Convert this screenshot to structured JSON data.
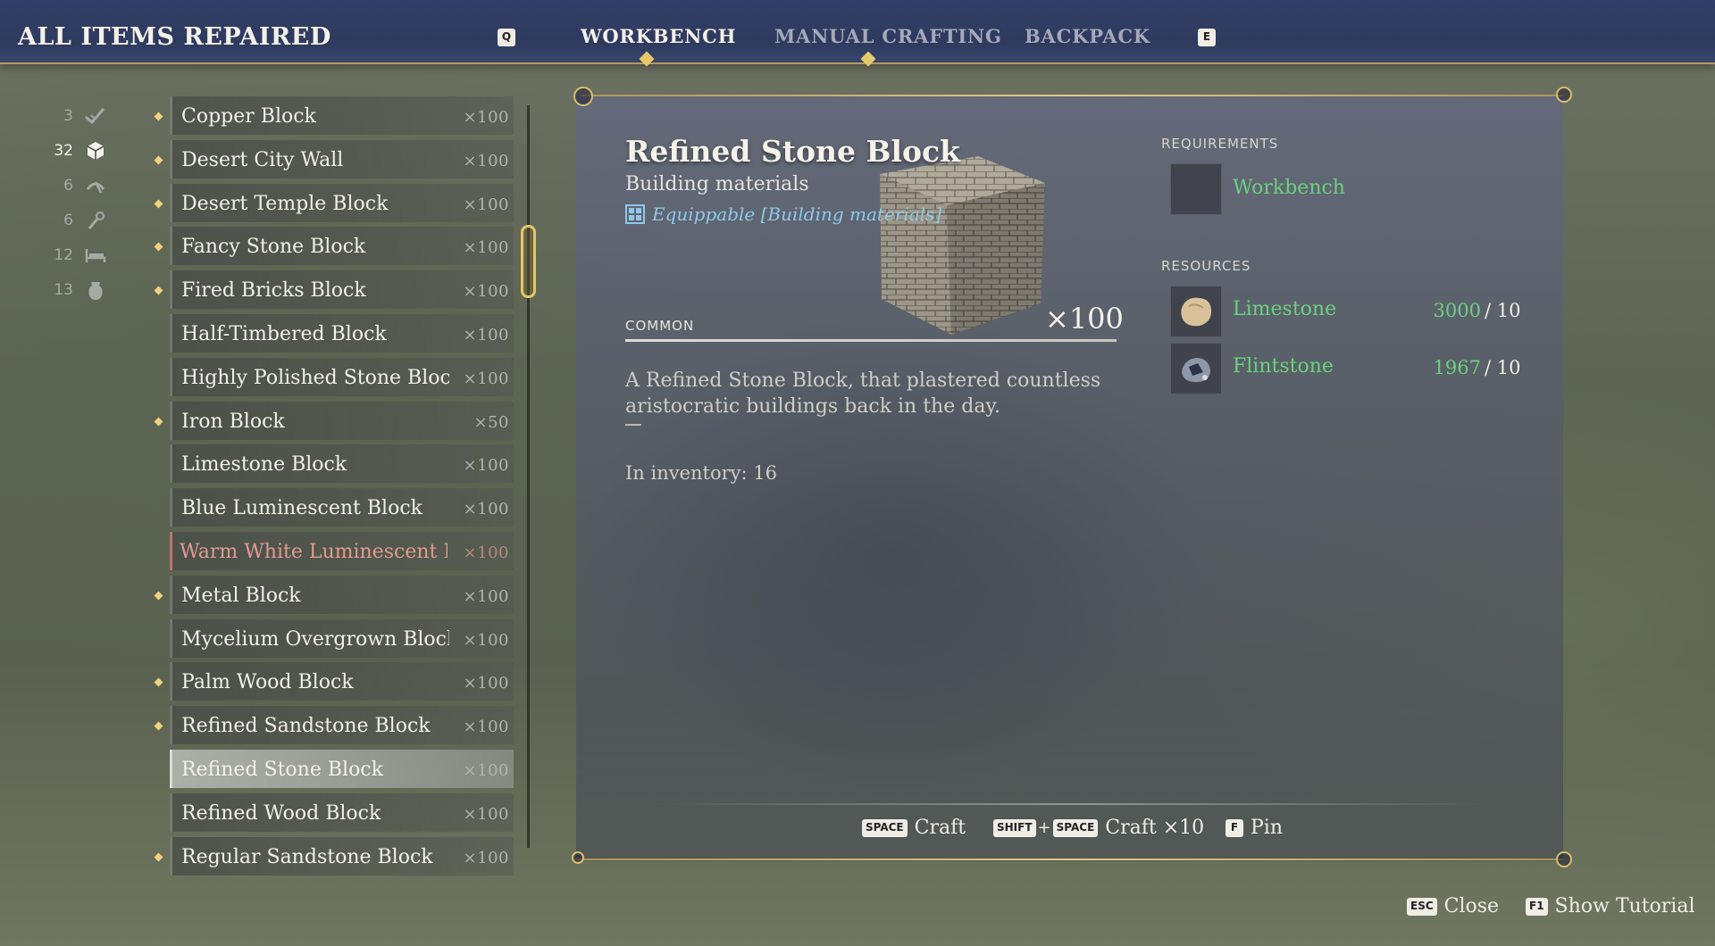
{
  "header": {
    "title": "ALL ITEMS REPAIRED",
    "key_prev": "Q",
    "key_next": "E",
    "tabs": [
      {
        "label": "WORKBENCH",
        "active": true
      },
      {
        "label": "MANUAL CRAFTING",
        "active": false
      },
      {
        "label": "BACKPACK",
        "active": false
      }
    ]
  },
  "categories": [
    {
      "count": "3",
      "icon": "checkmark-icon"
    },
    {
      "count": "32",
      "icon": "cube-icon",
      "active": true
    },
    {
      "count": "6",
      "icon": "pickaxe-icon"
    },
    {
      "count": "6",
      "icon": "torch-icon"
    },
    {
      "count": "12",
      "icon": "bed-icon"
    },
    {
      "count": "13",
      "icon": "jug-icon"
    }
  ],
  "recipes": [
    {
      "name": "Copper Block",
      "qty": "×100",
      "new": true
    },
    {
      "name": "Desert City Wall",
      "qty": "×100",
      "new": true
    },
    {
      "name": "Desert Temple Block",
      "qty": "×100",
      "new": true
    },
    {
      "name": "Fancy Stone Block",
      "qty": "×100",
      "new": true
    },
    {
      "name": "Fired Bricks Block",
      "qty": "×100",
      "new": true
    },
    {
      "name": "Half-Timbered Block",
      "qty": "×100",
      "new": false
    },
    {
      "name": "Highly Polished Stone Block",
      "qty": "×100",
      "new": false
    },
    {
      "name": "Iron Block",
      "qty": "×50",
      "new": true
    },
    {
      "name": "Limestone Block",
      "qty": "×100",
      "new": false
    },
    {
      "name": "Blue Luminescent Block",
      "qty": "×100",
      "new": false
    },
    {
      "name": "Warm White Luminescent Bl",
      "qty": "×100",
      "new": false,
      "locked": true
    },
    {
      "name": "Metal Block",
      "qty": "×100",
      "new": true
    },
    {
      "name": "Mycelium Overgrown Block",
      "qty": "×100",
      "new": false
    },
    {
      "name": "Palm Wood Block",
      "qty": "×100",
      "new": true
    },
    {
      "name": "Refined Sandstone Block",
      "qty": "×100",
      "new": true
    },
    {
      "name": "Refined Stone Block",
      "qty": "×100",
      "new": false,
      "selected": true
    },
    {
      "name": "Refined Wood Block",
      "qty": "×100",
      "new": false
    },
    {
      "name": "Regular Sandstone Block",
      "qty": "×100",
      "new": true
    }
  ],
  "detail": {
    "title": "Refined Stone Block",
    "subtitle": "Building materials",
    "equippable": "Equippable [Building materials]",
    "rarity": "COMMON",
    "quantity": "×100",
    "description": "A Refined Stone Block, that plastered countless aristocratic buildings back in the day.",
    "dash": "—",
    "inventory": "In inventory: 16",
    "requirements_label": "REQUIREMENTS",
    "requirement": "Workbench",
    "resources_label": "RESOURCES",
    "resources": [
      {
        "name": "Limestone",
        "have": "3000",
        "need": "/ 10",
        "icon": "limestone-icon"
      },
      {
        "name": "Flintstone",
        "have": "1967",
        "need": "/ 10",
        "icon": "flintstone-icon"
      }
    ]
  },
  "actions": {
    "craft_key": "SPACE",
    "craft_label": "Craft",
    "craft10_key1": "SHIFT",
    "plus": "+",
    "craft10_key2": "SPACE",
    "craft10_label": "Craft ×10",
    "pin_key": "F",
    "pin_label": "Pin"
  },
  "footer": {
    "close_key": "ESC",
    "close_label": "Close",
    "tutorial_key": "F1",
    "tutorial_label": "Show Tutorial"
  },
  "colors": {
    "header_bg": "#2e3a5e",
    "gold": "#e3c768",
    "resource_green": "#6cd07d",
    "locked_red": "#e29a8f",
    "equip_blue": "#8fc9ea"
  }
}
